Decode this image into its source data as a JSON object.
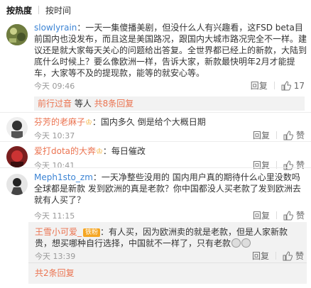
{
  "sort": {
    "hot": "按热度",
    "time": "按时间"
  },
  "comments": [
    {
      "user": "slowlyrain",
      "text": "一天一集傻播美剧，但没什么人有兴趣看，这FSD beta目前国内也没发布，而且这是美国路况，跟国内大城市路况完全不一样。建议还是就大家每天关心的问题给出答复。全世界都已经上的新款，大陆到底什么时候上？要么像欧洲一样，告诉大家，新款最快明年2月才能提车，大家等不及的提现款，能等的就安心等。",
      "time": "今天 09:46",
      "reply": "回复",
      "likes": "17",
      "sub_reply_prefix": "前行过音",
      "sub_reply_middle": " 等人 ",
      "sub_reply_link": "共8条回复"
    },
    {
      "user": "芬芳的老麻子",
      "badge": "♔",
      "text": "国内多久 倒是给个大概日期",
      "time": "今天 10:37",
      "reply": "回复",
      "likes": "赞"
    },
    {
      "user": "爱打dota的大奔",
      "badge": "♔",
      "text": "每日催改",
      "time": "今天 10:41",
      "reply": "回复",
      "likes": "赞"
    },
    {
      "user": "Meph1sto_zm",
      "text": "一天净整些没用的 国内用户真的期待什么心里没数吗 全球都是新款 发到欧洲的真是老款？你中国都没人买老款了发到欧洲去就有人买了？",
      "time": "今天 11:15",
      "reply": "回复",
      "likes": "赞"
    }
  ],
  "sub_comment": {
    "user": "王雪小可爱_",
    "badge": "铁粉",
    "text": "有人买，因为欧洲卖的就是老款，但是人家新款贵，想买哪种自行选择，中国就不一样了，只有老款",
    "time": "今天 13:39",
    "reply": "回复",
    "likes": "赞"
  },
  "footer_link": "共2条回复",
  "colors": {
    "accent": "#eb7350",
    "name_blue": "#3c84d4",
    "time": "#999999",
    "sub_bg": "#f2f2f2"
  }
}
